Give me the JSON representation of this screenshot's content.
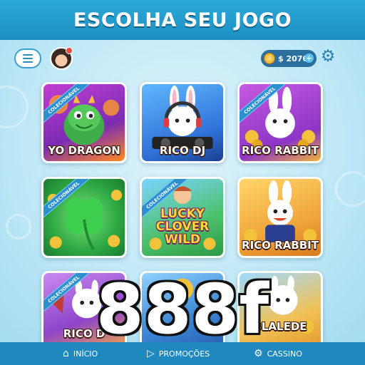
{
  "header": {
    "title": "ESCOLHA SEU JOGO"
  },
  "toolbar": {
    "menu_icon": "hamburger-icon",
    "avatar_icon": "user-avatar-icon",
    "balance": "$ 2070",
    "plus_label": "+",
    "settings_icon": "gear-icon"
  },
  "games": [
    {
      "title": "YO DRAGON",
      "ribbon": "COLECIONÁVEL",
      "bg": "#8b2fb8"
    },
    {
      "title": "RICO DJ",
      "ribbon": "",
      "bg": "#2f7fe0"
    },
    {
      "title": "RICO RABBIT",
      "ribbon": "COLECIONÁVEL",
      "bg": "#9a3bc9"
    },
    {
      "title": "",
      "ribbon": "COLECIONÁVEL",
      "bg": "#2ea843"
    },
    {
      "title": "LUCKY CLOVER WILD",
      "ribbon": "COLECIONÁVEL",
      "bg": "#43b84d"
    },
    {
      "title": "RICO RABBIT",
      "ribbon": "",
      "bg": "#e8a73a"
    },
    {
      "title": "RICO D",
      "ribbon": "COLECIONÁVEL",
      "bg": "#8d45c9"
    },
    {
      "title": "",
      "ribbon": "",
      "bg": "#3b86d6"
    },
    {
      "title": "BLALEDE",
      "ribbon": "",
      "bg": "#f0a63a"
    }
  ],
  "watermark": "888f",
  "nav": {
    "home": "INÍCIO",
    "promos": "PROMOÇÕES",
    "casino": "CASSINO"
  }
}
